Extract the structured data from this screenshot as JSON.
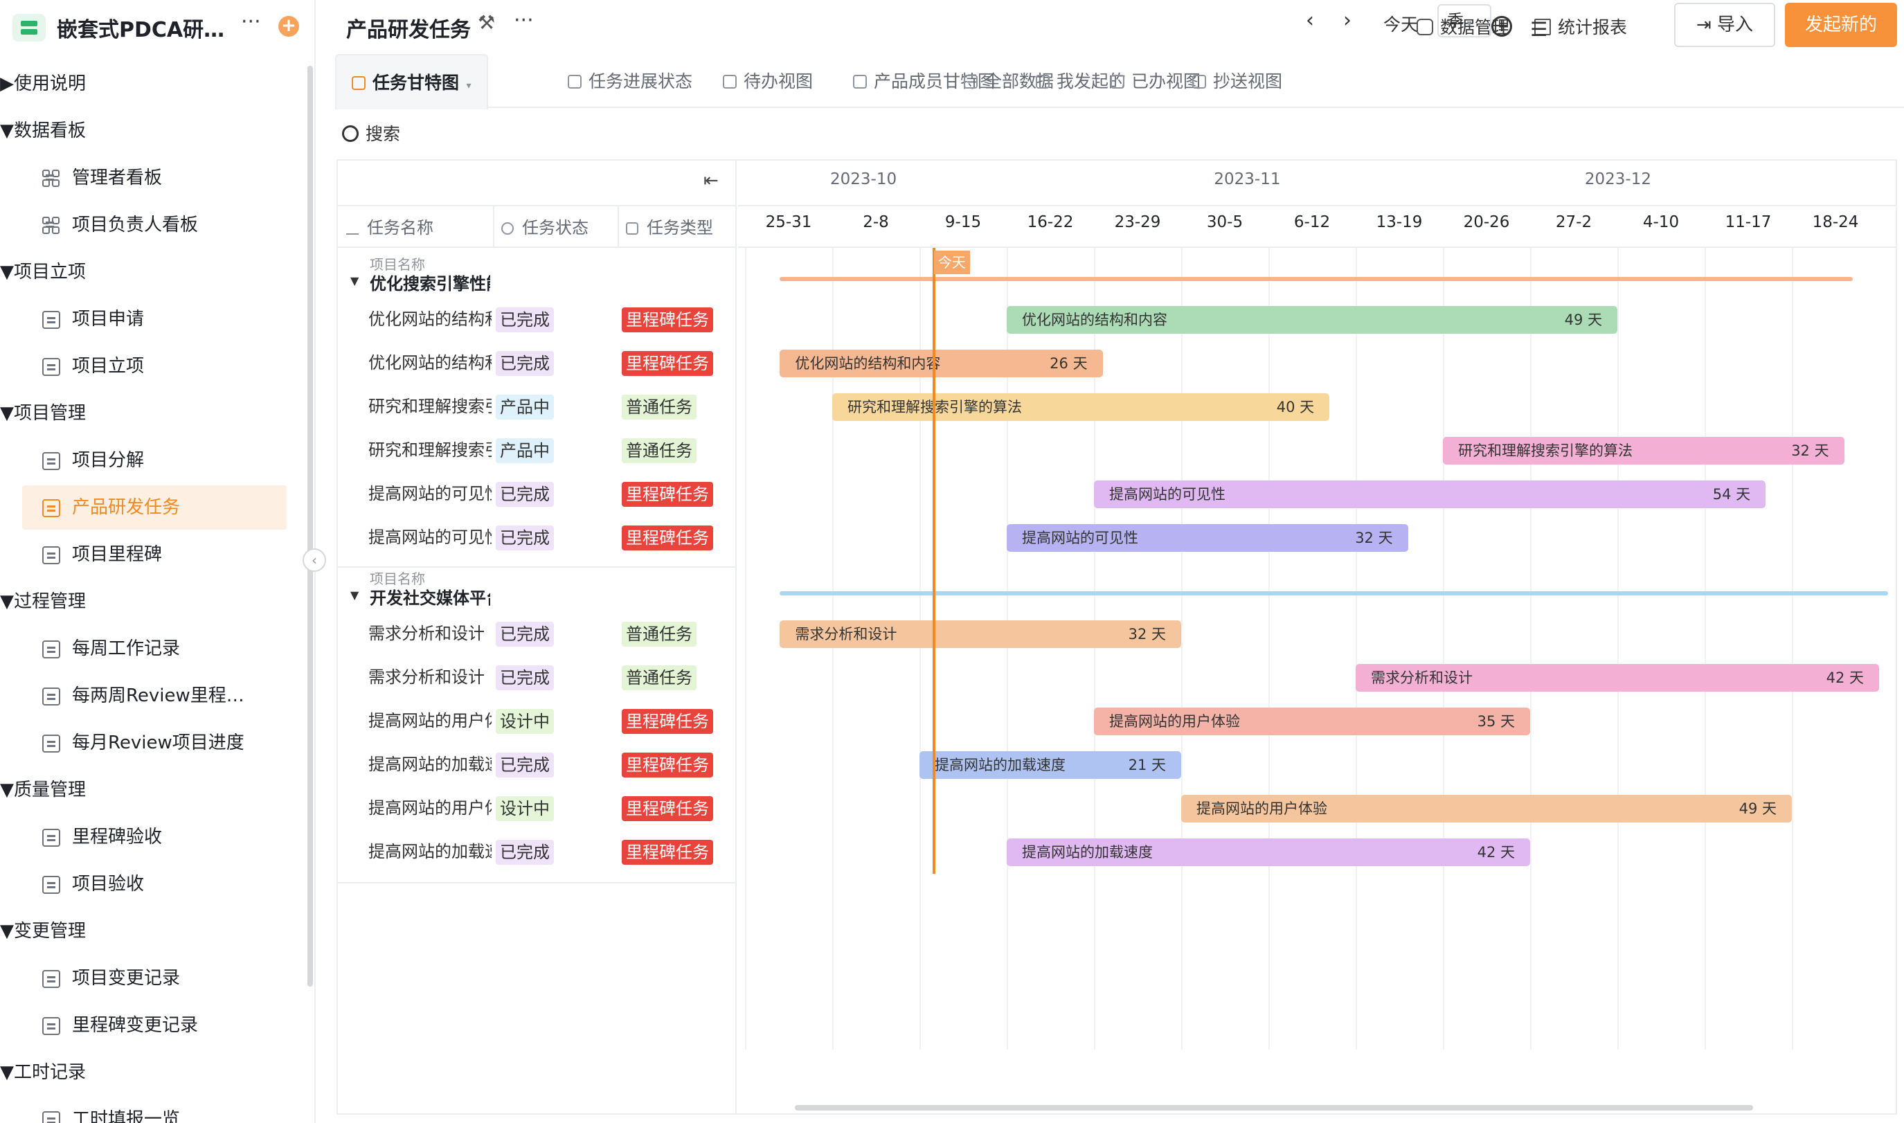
{
  "sidebar": {
    "app_title": "嵌套式PDCA研…",
    "items": [
      {
        "type": "group",
        "label": "使用说明",
        "expanded": false
      },
      {
        "type": "group",
        "label": "数据看板",
        "expanded": true
      },
      {
        "type": "sub",
        "label": "管理者看板",
        "icon": "dashboard-icon"
      },
      {
        "type": "sub",
        "label": "项目负责人看板",
        "icon": "dashboard-icon"
      },
      {
        "type": "group",
        "label": "项目立项",
        "expanded": true
      },
      {
        "type": "sub",
        "label": "项目申请",
        "icon": "form-icon"
      },
      {
        "type": "sub",
        "label": "项目立项",
        "icon": "form-icon"
      },
      {
        "type": "group",
        "label": "项目管理",
        "expanded": true
      },
      {
        "type": "sub",
        "label": "项目分解",
        "icon": "form-icon"
      },
      {
        "type": "sub",
        "label": "产品研发任务",
        "icon": "form-icon",
        "active": true
      },
      {
        "type": "sub",
        "label": "项目里程碑",
        "icon": "form-icon"
      },
      {
        "type": "group",
        "label": "过程管理",
        "expanded": true
      },
      {
        "type": "sub",
        "label": "每周工作记录",
        "icon": "form-icon"
      },
      {
        "type": "sub",
        "label": "每两周Review里程…",
        "icon": "form-icon"
      },
      {
        "type": "sub",
        "label": "每月Review项目进度",
        "icon": "form-icon"
      },
      {
        "type": "group",
        "label": "质量管理",
        "expanded": true
      },
      {
        "type": "sub",
        "label": "里程碑验收",
        "icon": "form-icon"
      },
      {
        "type": "sub",
        "label": "项目验收",
        "icon": "form-icon"
      },
      {
        "type": "group",
        "label": "变更管理",
        "expanded": true
      },
      {
        "type": "sub",
        "label": "项目变更记录",
        "icon": "form-icon"
      },
      {
        "type": "sub",
        "label": "里程碑变更记录",
        "icon": "form-icon"
      },
      {
        "type": "group",
        "label": "工时记录",
        "expanded": true
      },
      {
        "type": "sub",
        "label": "工时填报一览",
        "icon": "form-icon"
      }
    ]
  },
  "header": {
    "title": "产品研发任务",
    "data_mgmt": "数据管理",
    "reports": "统计报表",
    "import_label": "导入",
    "start_label": "发起新的"
  },
  "tabs": [
    {
      "label": "任务甘特图",
      "active": true
    },
    {
      "label": "任务进展状态"
    },
    {
      "label": "待办视图"
    },
    {
      "label": "产品成员甘特图"
    },
    {
      "label": "全部数据"
    },
    {
      "label": "我发起的"
    },
    {
      "label": "已办视图"
    },
    {
      "label": "抄送视图"
    }
  ],
  "search": {
    "label": "搜索"
  },
  "columns": {
    "name": "任务名称",
    "status": "任务状态",
    "type": "任务类型"
  },
  "timeline": {
    "months": [
      "2023-10",
      "2023-11",
      "2023-12"
    ],
    "weeks": [
      "25-31",
      "2-8",
      "9-15",
      "16-22",
      "23-29",
      "30-5",
      "6-12",
      "13-19",
      "20-26",
      "27-2",
      "4-10",
      "11-17",
      "18-24"
    ],
    "today_label": "今天",
    "today_button": "今天",
    "scale": "季",
    "today_week_offset": 2.15
  },
  "colors": {
    "accent": "#f08a24",
    "group1_bar": "#f6b48a",
    "group2_bar": "#a9d6f5"
  },
  "groups": [
    {
      "caption": "项目名称",
      "name": "优化搜索引擎性能",
      "span": {
        "start": 0.4,
        "end": 12.7
      },
      "line_color": "#f6b48a",
      "rows": [
        {
          "name": "优化网站的结构和内容",
          "status": "已完成",
          "status_class": "st-done",
          "type": "里程碑任务",
          "type_class": "ty-mile",
          "bar_label": "优化网站的结构和内容",
          "days": "49 天",
          "start": 3.0,
          "end": 10.0,
          "color": "#acdcb6"
        },
        {
          "name": "优化网站的结构和内容",
          "status": "已完成",
          "status_class": "st-done",
          "type": "里程碑任务",
          "type_class": "ty-mile",
          "bar_label": "优化网站的结构和内容",
          "days": "26 天",
          "start": 0.4,
          "end": 4.1,
          "color": "#f5b891"
        },
        {
          "name": "研究和理解搜索引擎的算法",
          "status": "产品中",
          "status_class": "st-prod",
          "type": "普通任务",
          "type_class": "ty-norm",
          "bar_label": "研究和理解搜索引擎的算法",
          "days": "40 天",
          "start": 1.0,
          "end": 6.7,
          "color": "#f7d89a"
        },
        {
          "name": "研究和理解搜索引擎的算法",
          "status": "产品中",
          "status_class": "st-prod",
          "type": "普通任务",
          "type_class": "ty-norm",
          "bar_label": "研究和理解搜索引擎的算法",
          "days": "32 天",
          "start": 8.0,
          "end": 12.6,
          "color": "#f3b0d4"
        },
        {
          "name": "提高网站的可见性",
          "status": "已完成",
          "status_class": "st-done",
          "type": "里程碑任务",
          "type_class": "ty-mile",
          "bar_label": "提高网站的可见性",
          "days": "54 天",
          "start": 4.0,
          "end": 11.7,
          "color": "#e0b8f2"
        },
        {
          "name": "提高网站的可见性",
          "status": "已完成",
          "status_class": "st-done",
          "type": "里程碑任务",
          "type_class": "ty-mile",
          "bar_label": "提高网站的可见性",
          "days": "32 天",
          "start": 3.0,
          "end": 7.6,
          "color": "#b7b3f2"
        }
      ]
    },
    {
      "caption": "项目名称",
      "name": "开发社交媒体平台",
      "span": {
        "start": 0.4,
        "end": 13.1
      },
      "line_color": "#a9d6f5",
      "rows": [
        {
          "name": "需求分析和设计",
          "status": "已完成",
          "status_class": "st-done",
          "type": "普通任务",
          "type_class": "ty-norm",
          "bar_label": "需求分析和设计",
          "days": "32 天",
          "start": 0.4,
          "end": 5.0,
          "color": "#f5c69d"
        },
        {
          "name": "需求分析和设计",
          "status": "已完成",
          "status_class": "st-done",
          "type": "普通任务",
          "type_class": "ty-norm",
          "bar_label": "需求分析和设计",
          "days": "42 天",
          "start": 7.0,
          "end": 13.0,
          "color": "#f3b0d4"
        },
        {
          "name": "提高网站的用户体验",
          "status": "设计中",
          "status_class": "st-design",
          "type": "里程碑任务",
          "type_class": "ty-mile",
          "bar_label": "提高网站的用户体验",
          "days": "35 天",
          "start": 4.0,
          "end": 9.0,
          "color": "#f5b3a8"
        },
        {
          "name": "提高网站的加载速度",
          "status": "已完成",
          "status_class": "st-done",
          "type": "里程碑任务",
          "type_class": "ty-mile",
          "bar_label": "提高网站的加载速度",
          "days": "21 天",
          "start": 2.0,
          "end": 5.0,
          "color": "#aec3f2"
        },
        {
          "name": "提高网站的用户体验",
          "status": "设计中",
          "status_class": "st-design",
          "type": "里程碑任务",
          "type_class": "ty-mile",
          "bar_label": "提高网站的用户体验",
          "days": "49 天",
          "start": 5.0,
          "end": 12.0,
          "color": "#f5c69d"
        },
        {
          "name": "提高网站的加载速度",
          "status": "已完成",
          "status_class": "st-done",
          "type": "里程碑任务",
          "type_class": "ty-mile",
          "bar_label": "提高网站的加载速度",
          "days": "42 天",
          "start": 3.0,
          "end": 9.0,
          "color": "#e0b8f2"
        }
      ]
    }
  ]
}
